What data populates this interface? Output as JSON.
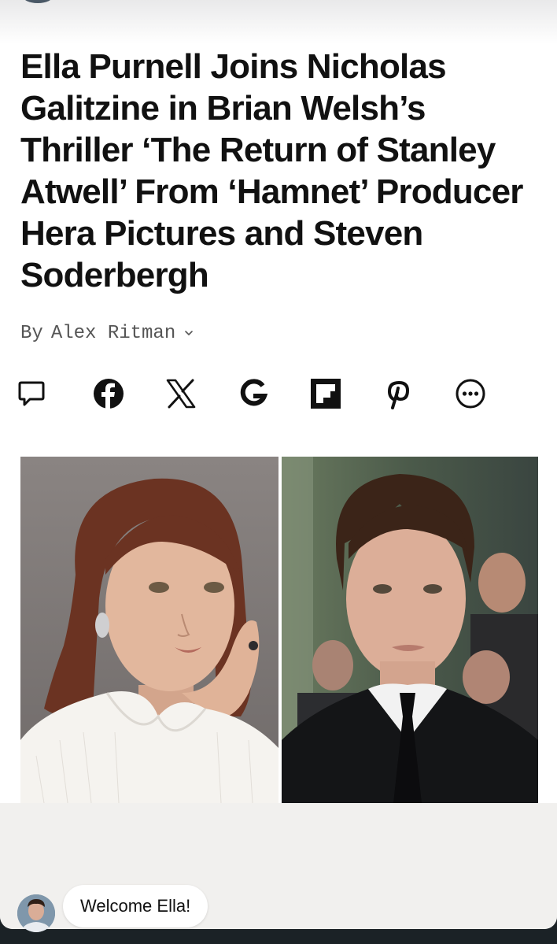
{
  "article": {
    "headline": "Ella Purnell Joins Nicholas Galitzine in Brian Welsh’s Thriller ‘The Return of Stanley Atwell’ From ‘Hamnet’ Producer Hera Pictures and Steven Soderbergh",
    "byline_prefix": "By",
    "author": "Alex Ritman"
  },
  "share": {
    "icons": [
      "comment-icon",
      "facebook-icon",
      "x-icon",
      "google-icon",
      "flipboard-icon",
      "pinterest-icon",
      "more-icon"
    ]
  },
  "chat": {
    "message": "Welcome Ella!"
  },
  "colors": {
    "text": "#111111",
    "byline": "#555555",
    "footer_bg": "#f1f0ee"
  }
}
